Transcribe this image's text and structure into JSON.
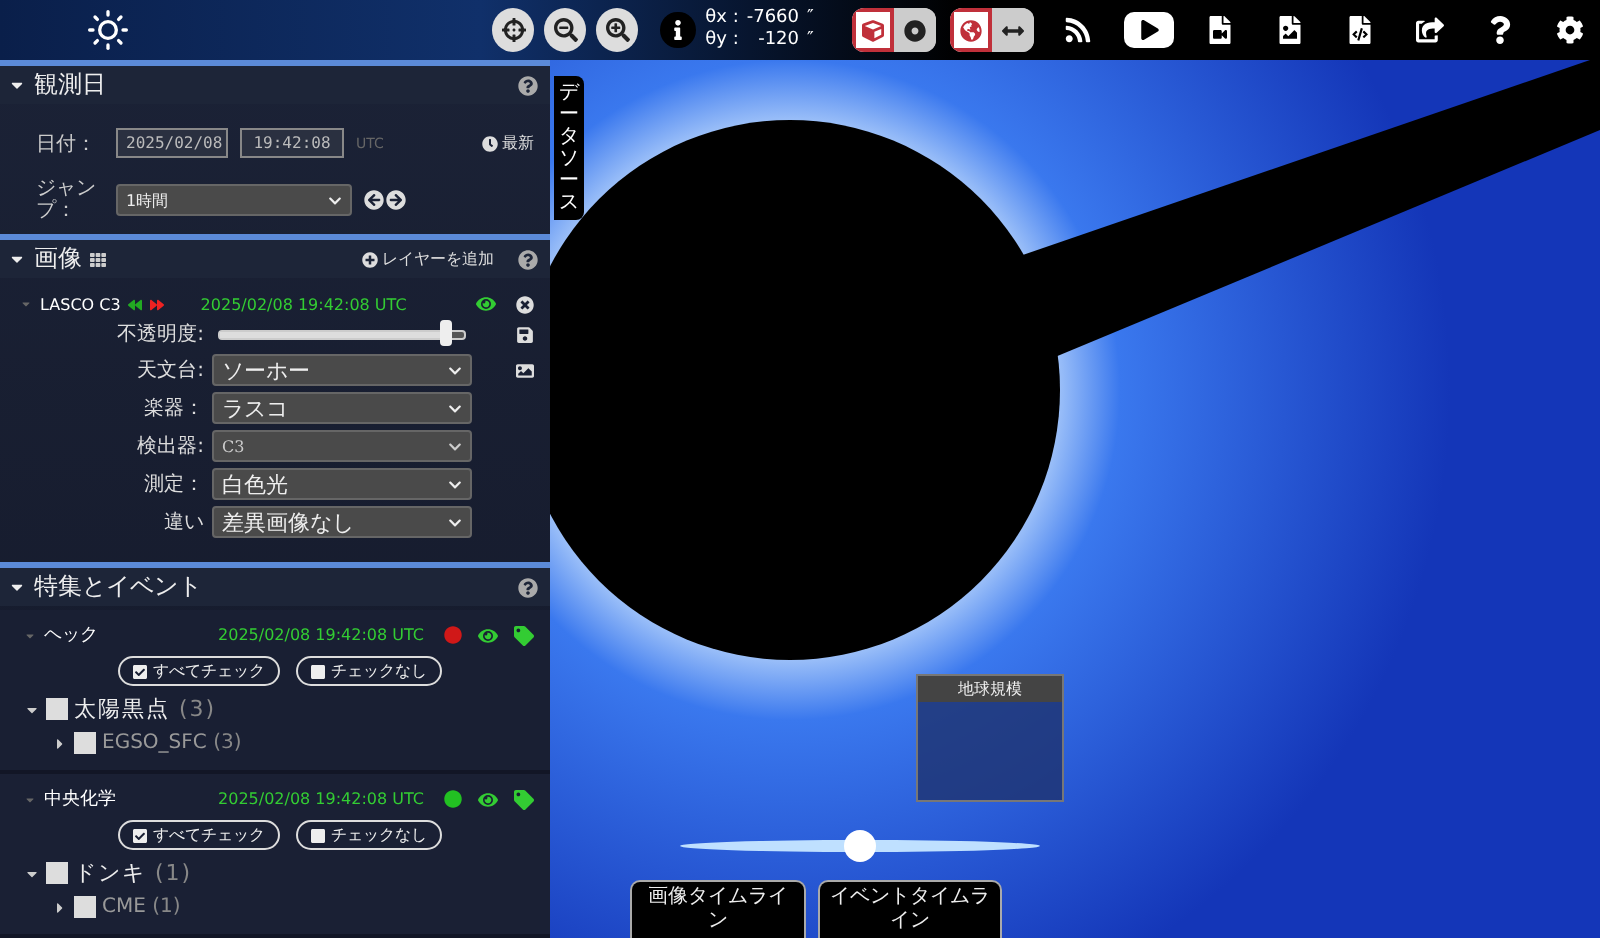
{
  "toolbar": {
    "view_buttons": [
      {
        "kind": "center"
      },
      {
        "kind": "zoom_out"
      },
      {
        "kind": "zoom_in"
      }
    ],
    "coords": [
      {
        "label": "θx",
        "sep": ":",
        "value": "-7660",
        "unit": "″"
      },
      {
        "label": "θy",
        "sep": ":",
        "value": "-120",
        "unit": "″"
      }
    ],
    "toggles": [
      {
        "options": [
          {
            "kind": "cube",
            "selected": true
          },
          {
            "kind": "target",
            "selected": false
          }
        ]
      },
      {
        "options": [
          {
            "kind": "globe",
            "selected": true
          },
          {
            "kind": "arrows",
            "selected": false
          }
        ]
      }
    ],
    "actions": [
      {
        "kind": "rss"
      },
      {
        "kind": "play"
      },
      {
        "kind": "video"
      },
      {
        "kind": "image"
      },
      {
        "kind": "code"
      },
      {
        "kind": "share"
      },
      {
        "kind": "help"
      },
      {
        "kind": "settings"
      }
    ]
  },
  "observation_date": {
    "title": "観測日",
    "date_label": "日付：",
    "date": "2025/02/08",
    "time": "19:42:08",
    "timezone": "UTC",
    "latest": "最新",
    "jump_label": "ジャンプ：",
    "jump_value": "1時間"
  },
  "images": {
    "title": "画像",
    "add_layer": "レイヤーを追加",
    "layers": [
      {
        "name": "LASCO C3",
        "timestamp": "2025/02/08 19:42:08 UTC",
        "visible": true,
        "opacity_label": "不透明度:",
        "level": 0.93,
        "fields": [
          {
            "label": "天文台:",
            "value": "ソーホー",
            "kind": "large"
          },
          {
            "label": "楽器：",
            "value": "ラスコ",
            "kind": "large"
          },
          {
            "label": "検出器:",
            "value": "C3",
            "kind": "small"
          },
          {
            "label": "測定：",
            "value": "白色光",
            "kind": "large"
          },
          {
            "label": "違い",
            "value": "差異画像なし",
            "kind": "large"
          }
        ]
      }
    ]
  },
  "features": {
    "title": "特集とイベント",
    "groups": [
      {
        "name": "ヘック",
        "timestamp": "2025/02/08 19:42:08 UTC",
        "color": "#d01818",
        "visible": true,
        "check_all": "すべてチェック",
        "check_none": "チェックなし",
        "tree": [
          {
            "label": "太陽黒点",
            "count": "(3)",
            "checked": false,
            "expanded": true,
            "children": [
              {
                "label": "EGSO_SFC",
                "count": "(3)",
                "checked": false,
                "expanded": false
              }
            ]
          }
        ]
      },
      {
        "name": "中央化学",
        "timestamp": "2025/02/08 19:42:08 UTC",
        "color": "#22c022",
        "visible": true,
        "check_all": "すべてチェック",
        "check_none": "チェックなし",
        "tree": [
          {
            "label": "ドンキ",
            "count": "(1)",
            "checked": false,
            "expanded": true,
            "children": [
              {
                "label": "CME",
                "count": "(1)",
                "checked": false,
                "expanded": false
              }
            ]
          }
        ]
      }
    ]
  },
  "data_source_tab": "データソース",
  "scale_box": {
    "title": "地球規模"
  },
  "timeline_tabs": [
    "画像タイムライン",
    "イベントタイムライン"
  ]
}
